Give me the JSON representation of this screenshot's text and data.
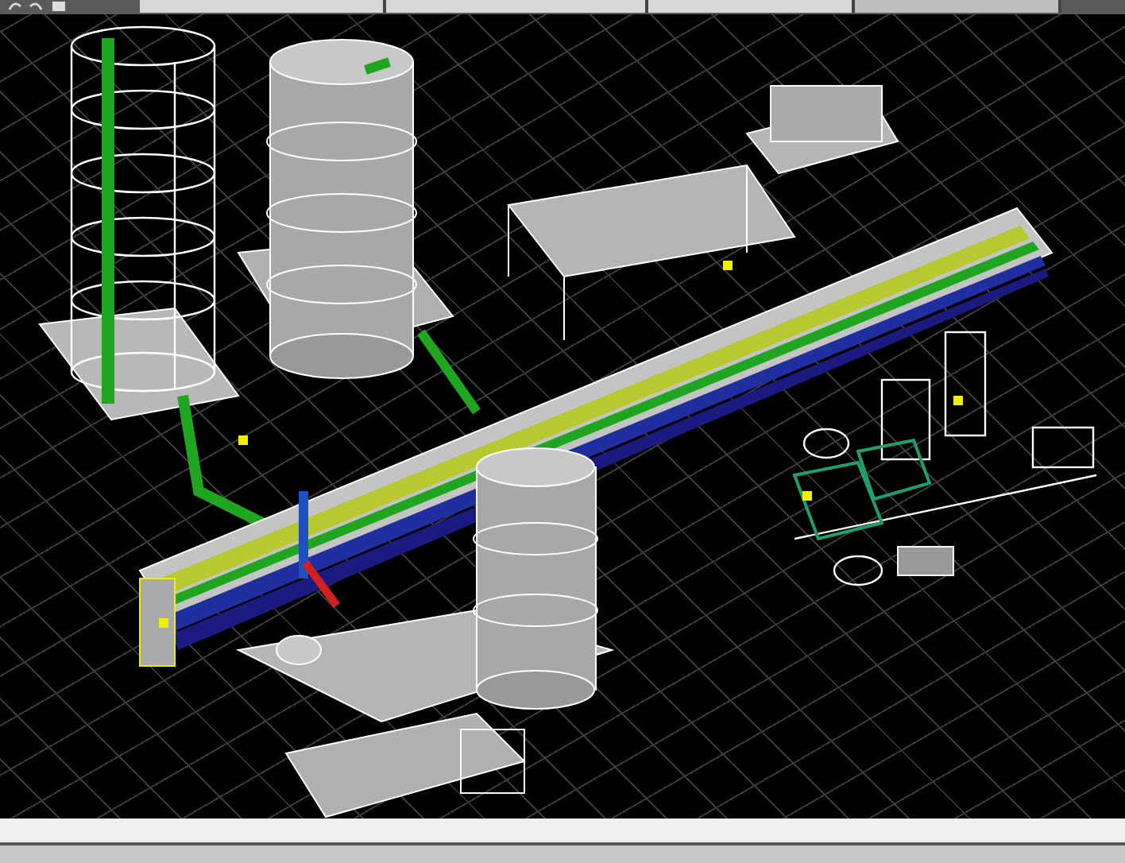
{
  "tab_bar": {
    "tabs": [
      {
        "selected": false
      },
      {
        "selected": false
      },
      {
        "selected": false
      },
      {
        "selected": true
      }
    ]
  }
}
